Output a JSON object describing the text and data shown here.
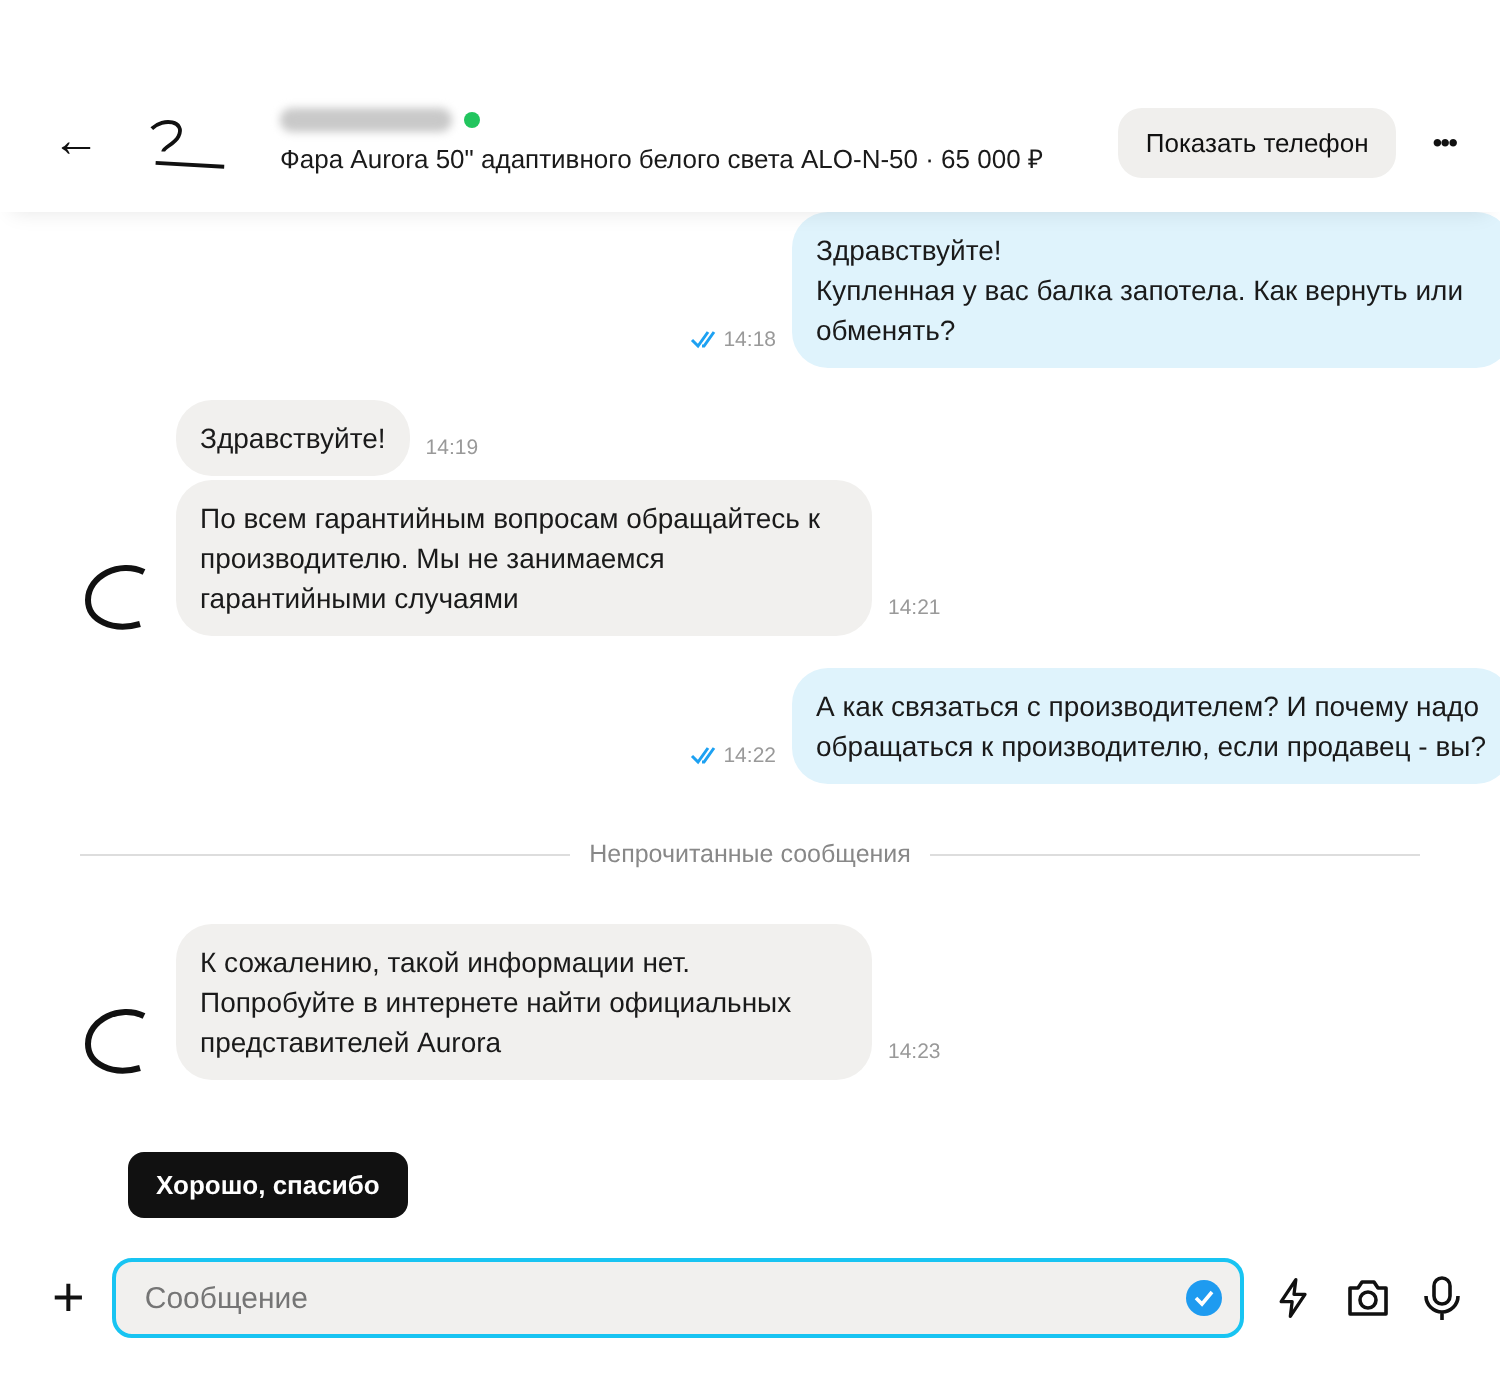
{
  "header": {
    "back": "←",
    "seller_online": true,
    "listing": "Фара Aurora 50\" адаптивного белого света ALO-N-50 · 65 000 ₽",
    "show_phone": "Показать телефон",
    "more": "•••"
  },
  "messages": [
    {
      "kind": "outgoing",
      "text": "Здравствуйте!\nКупленная у вас балка запотела. Как вернуть или обменять?",
      "time": "14:18",
      "read": true
    },
    {
      "kind": "incoming",
      "text": "Здравствуйте!",
      "time": "14:19",
      "avatar": false
    },
    {
      "kind": "incoming",
      "text": "По всем гарантийным вопросам обращайтесь к производителю. Мы не занимаемся гарантийными случаями",
      "time": "14:21",
      "avatar": true
    },
    {
      "kind": "outgoing",
      "text": "А как связаться с производителем? И почему надо обращаться к производителю, если продавец - вы?",
      "time": "14:22",
      "read": true
    },
    {
      "kind": "divider",
      "text": "Непрочитанные сообщения"
    },
    {
      "kind": "incoming",
      "text": "К сожалению, такой информации нет. Попробуйте в интернете найти официальных представителей Aurora",
      "time": "14:23",
      "avatar": true
    }
  ],
  "quick_replies": [
    "Хорошо, спасибо"
  ],
  "composer": {
    "add": "+",
    "placeholder": "Сообщение",
    "focused": true
  }
}
